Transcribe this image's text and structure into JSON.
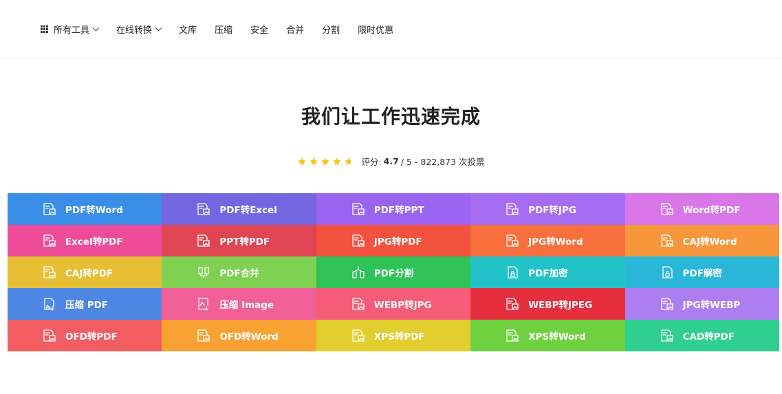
{
  "nav": {
    "items": [
      {
        "label": "所有工具",
        "icon": "grid-icon",
        "dropdown": true
      },
      {
        "label": "在线转换",
        "dropdown": true
      },
      {
        "label": "文库"
      },
      {
        "label": "压缩"
      },
      {
        "label": "安全"
      },
      {
        "label": "合并"
      },
      {
        "label": "分割"
      },
      {
        "label": "限时优惠"
      }
    ]
  },
  "hero": {
    "title": "我们让工作迅速完成"
  },
  "rating": {
    "prefix": "评分:",
    "score": "4.7",
    "suffix": "/ 5 - 822,873 次投票",
    "stars": 4.7,
    "star_color": "#f5c518"
  },
  "tools": [
    {
      "label": "PDF转Word",
      "color": "#3b8ee8",
      "icon": "document-image-icon"
    },
    {
      "label": "PDF转Excel",
      "color": "#7366e0",
      "icon": "document-image-icon"
    },
    {
      "label": "PDF转PPT",
      "color": "#9a64f0",
      "icon": "document-image-icon"
    },
    {
      "label": "PDF转JPG",
      "color": "#a66cf2",
      "icon": "document-image-icon"
    },
    {
      "label": "Word转PDF",
      "color": "#d977e8",
      "icon": "document-image-icon"
    },
    {
      "label": "Excel转PDF",
      "color": "#ee4c98",
      "icon": "document-image-icon"
    },
    {
      "label": "PPT转PDF",
      "color": "#e04553",
      "icon": "document-image-icon"
    },
    {
      "label": "JPG转PDF",
      "color": "#f3523f",
      "icon": "document-image-icon"
    },
    {
      "label": "JPG转Word",
      "color": "#f66f3d",
      "icon": "document-image-icon"
    },
    {
      "label": "CAJ转Word",
      "color": "#f7963a",
      "icon": "document-image-icon"
    },
    {
      "label": "CAJ转PDF",
      "color": "#e7bf35",
      "icon": "document-image-icon"
    },
    {
      "label": "PDF合并",
      "color": "#7fd152",
      "icon": "merge-icon"
    },
    {
      "label": "PDF分割",
      "color": "#2fc257",
      "icon": "split-icon"
    },
    {
      "label": "PDF加密",
      "color": "#22c3c8",
      "icon": "lock-icon"
    },
    {
      "label": "PDF解密",
      "color": "#2ab6d9",
      "icon": "unlock-icon"
    },
    {
      "label": "压缩 PDF",
      "color": "#4e86e4",
      "icon": "compress-icon"
    },
    {
      "label": "压缩 Image",
      "color": "#f26098",
      "icon": "compress-image-icon"
    },
    {
      "label": "WEBP转JPG",
      "color": "#f55c77",
      "icon": "document-image-icon"
    },
    {
      "label": "WEBP转JPEG",
      "color": "#e52f3f",
      "icon": "document-image-icon"
    },
    {
      "label": "JPG转WEBP",
      "color": "#ad7ef0",
      "icon": "document-image-icon"
    },
    {
      "label": "OFD转PDF",
      "color": "#f25d62",
      "icon": "document-image-icon"
    },
    {
      "label": "OFD转Word",
      "color": "#f9a234",
      "icon": "document-image-icon"
    },
    {
      "label": "XPS转PDF",
      "color": "#e2cf2e",
      "icon": "document-image-icon"
    },
    {
      "label": "XPS转Word",
      "color": "#6fd13f",
      "icon": "document-image-icon"
    },
    {
      "label": "CAD转PDF",
      "color": "#2ecf90",
      "icon": "document-image-icon"
    }
  ]
}
